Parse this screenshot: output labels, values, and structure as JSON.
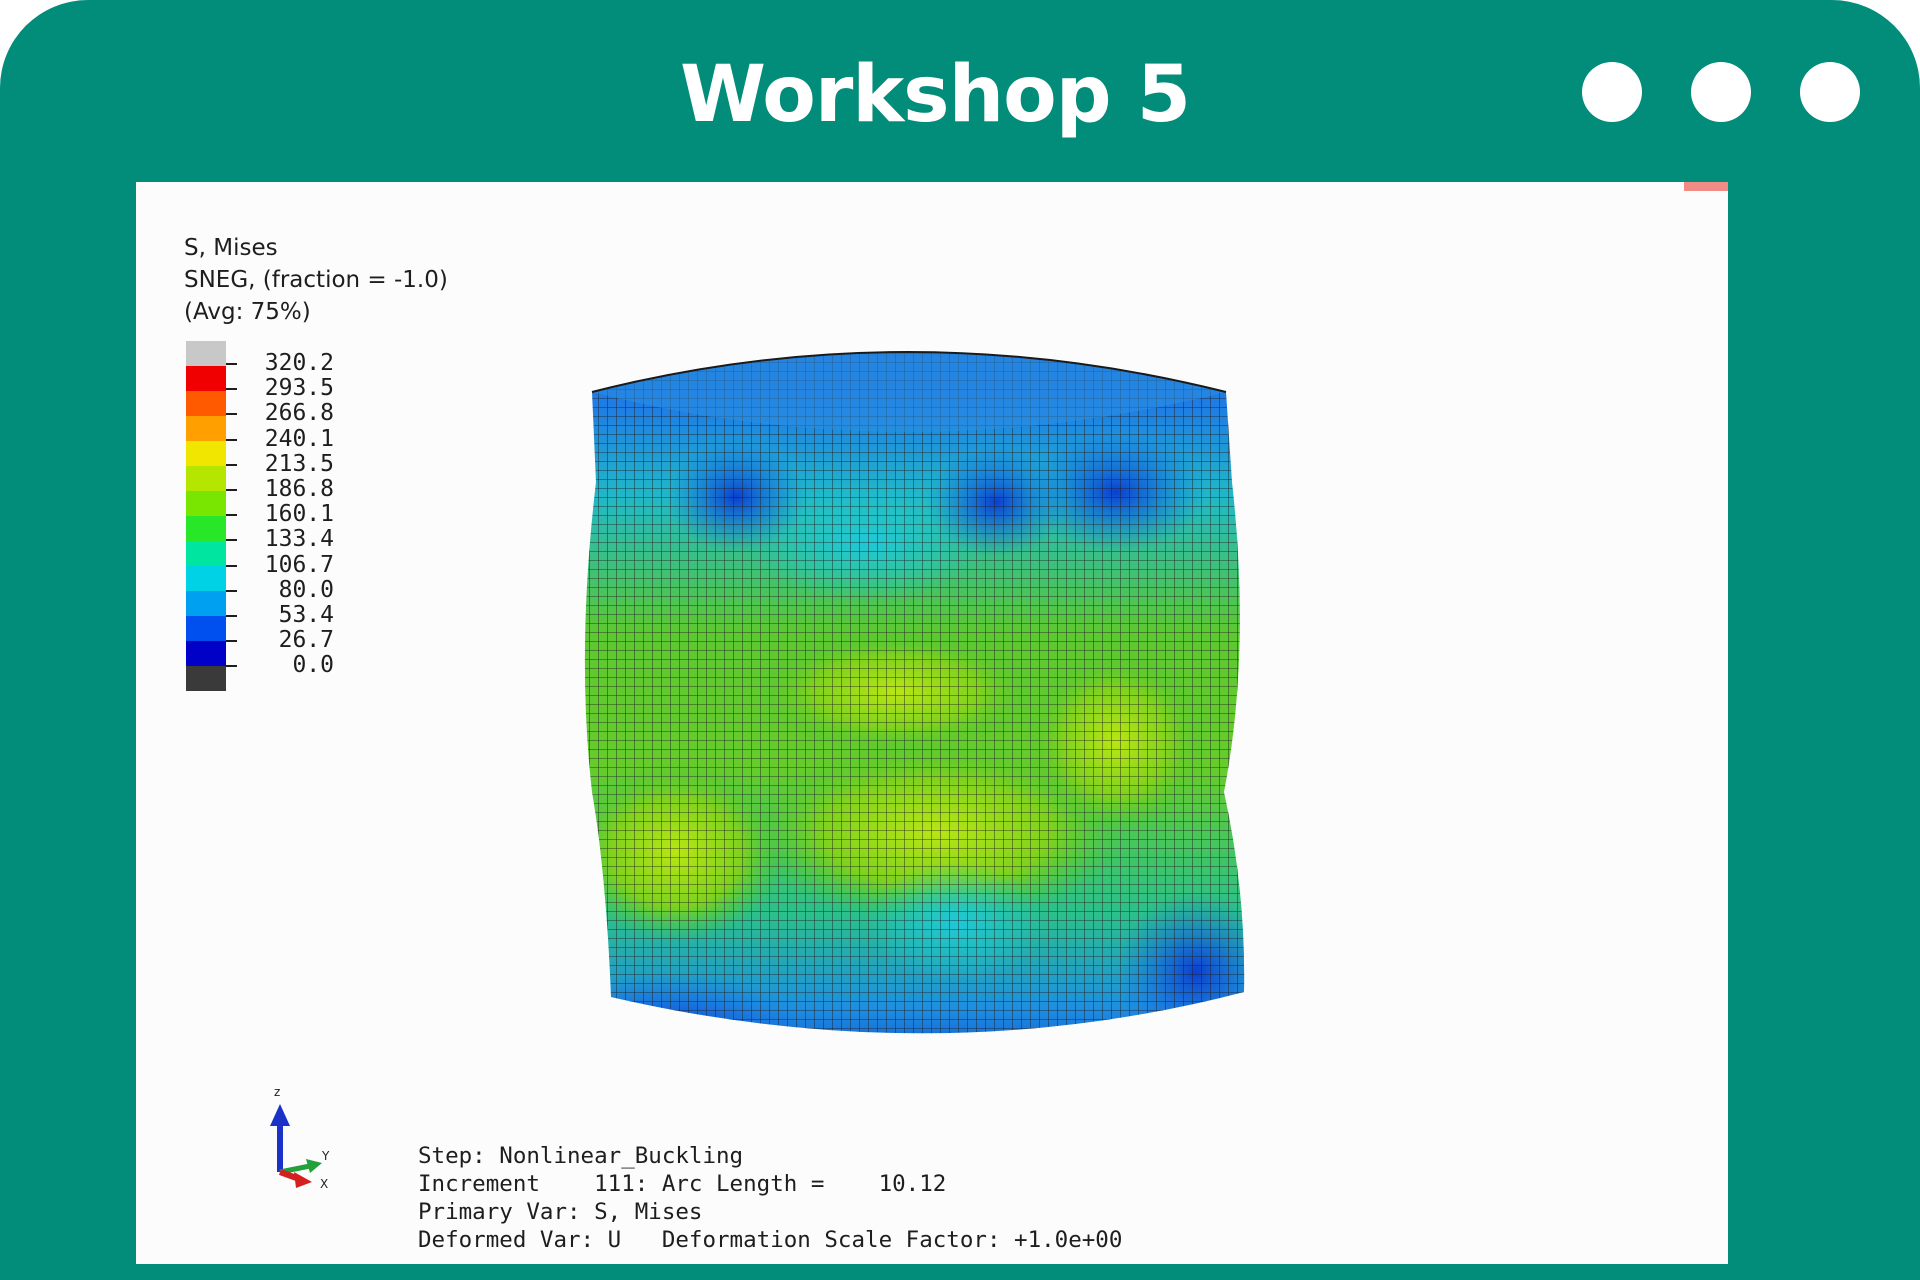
{
  "window": {
    "title": "Workshop 5",
    "controls": [
      "dot",
      "dot",
      "dot"
    ],
    "colors": {
      "frame": "#028c7a",
      "viewport": "#fcfcfc",
      "title_text": "#ffffff"
    }
  },
  "legend": {
    "line1": "S, Mises",
    "line2": "SNEG, (fraction = -1.0)",
    "line3": "(Avg: 75%)",
    "swatch_colors": [
      "#c8c8c8",
      "#f00000",
      "#ff5a00",
      "#ffa000",
      "#f0e600",
      "#b4e600",
      "#78e600",
      "#28e628",
      "#00e6a0",
      "#00d2e6",
      "#00a0f0",
      "#0050f0",
      "#0000c8",
      "#3a3a3a"
    ],
    "values": [
      "320.2",
      "293.5",
      "266.8",
      "240.1",
      "213.5",
      "186.8",
      "160.1",
      "133.4",
      "106.7",
      "80.0",
      "53.4",
      "26.7",
      "0.0"
    ]
  },
  "triad": {
    "z_label": "z",
    "y_label": "Y",
    "x_label": "X"
  },
  "step_info": {
    "step": "Step: Nonlinear_Buckling",
    "increment": "Increment    111: Arc Length =    10.12",
    "primary_var": "Primary Var: S, Mises",
    "deformed_var": "Deformed Var: U   Deformation Scale Factor: +1.0e+00"
  },
  "model": {
    "name": "deformed-cylinder",
    "mesh_color": "#1a1a1a"
  }
}
